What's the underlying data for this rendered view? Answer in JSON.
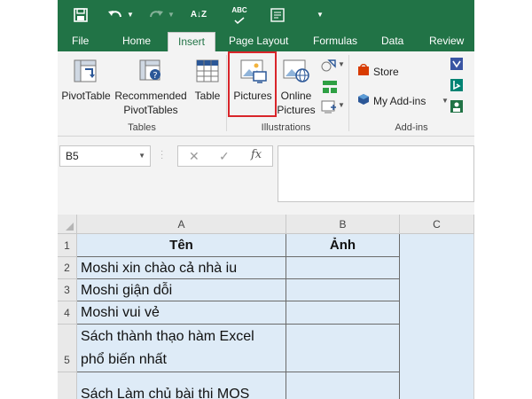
{
  "quick_access": {
    "save_icon": "save-icon",
    "undo_icon": "undo-icon",
    "redo_icon": "redo-icon",
    "sort_label": "A↓Z",
    "spelling_label": "ABC"
  },
  "tabs": [
    {
      "label": "File"
    },
    {
      "label": "Home"
    },
    {
      "label": "Insert",
      "active": true
    },
    {
      "label": "Page Layout"
    },
    {
      "label": "Formulas"
    },
    {
      "label": "Data"
    },
    {
      "label": "Review"
    }
  ],
  "ribbon": {
    "tables": {
      "label": "Tables",
      "pivottable": "PivotTable",
      "recommended_line1": "Recommended",
      "recommended_line2": "PivotTables",
      "table": "Table"
    },
    "illustrations": {
      "label": "Illustrations",
      "pictures": "Pictures",
      "online_line1": "Online",
      "online_line2": "Pictures"
    },
    "addins": {
      "label": "Add-ins",
      "store": "Store",
      "my_addins": "My Add-ins"
    }
  },
  "formula_bar": {
    "name_box": "B5",
    "cancel_glyph": "✕",
    "enter_glyph": "✓",
    "fx_label": "fx",
    "formula_value": ""
  },
  "sheet": {
    "columns": [
      "A",
      "B",
      "C"
    ],
    "rows": [
      {
        "num": "1",
        "a": "Tên",
        "b": "Ảnh"
      },
      {
        "num": "2",
        "a": "Moshi xin chào cả nhà iu",
        "b": ""
      },
      {
        "num": "3",
        "a": "Moshi giận dỗi",
        "b": ""
      },
      {
        "num": "4",
        "a": "Moshi vui vẻ",
        "b": ""
      },
      {
        "num": "5",
        "a_line1": "Sách thành thạo hàm Excel",
        "a_line2": "phổ biến nhất",
        "b": ""
      },
      {
        "num": "",
        "a": "Sách Làm chủ bài thi MOS",
        "b": ""
      }
    ]
  },
  "colors": {
    "excel_green": "#217346",
    "cell_fill": "#deebf7",
    "highlight_red": "#d9252a"
  }
}
